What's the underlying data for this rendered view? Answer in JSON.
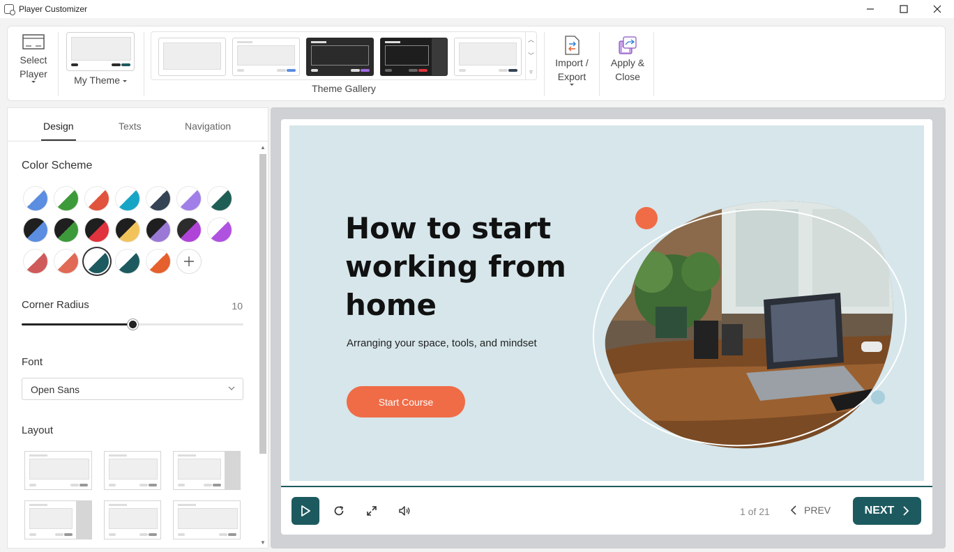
{
  "window": {
    "title": "Player Customizer"
  },
  "ribbon": {
    "select_player": "Select Player",
    "my_theme": "My Theme",
    "theme_gallery": "Theme Gallery",
    "import_export": "Import / Export",
    "apply_close": "Apply & Close"
  },
  "panel": {
    "tabs": [
      "Design",
      "Texts",
      "Navigation"
    ],
    "active_tab": "Design",
    "color_scheme_title": "Color Scheme",
    "corner_radius_title": "Corner Radius",
    "corner_radius_value": "10",
    "corner_radius_level": 0.5,
    "font_title": "Font",
    "font_value": "Open Sans",
    "layout_title": "Layout"
  },
  "colors": {
    "accent": "#1d5a5f",
    "button_orange": "#ef6c47",
    "slide_bg": "#d6e6eb"
  },
  "swatches": [
    [
      "#ffffff",
      "#5b8de0"
    ],
    [
      "#ffffff",
      "#3d9a3a"
    ],
    [
      "#ffffff",
      "#e0533d"
    ],
    [
      "#ffffff",
      "#17a5c6"
    ],
    [
      "#ffffff",
      "#354454"
    ],
    [
      "#ffffff",
      "#a07fe8"
    ],
    [
      "#ffffff",
      "#1f5e55"
    ],
    [
      "#1f1f1f",
      "#5b8de0"
    ],
    [
      "#1f1f1f",
      "#3d9a3a"
    ],
    [
      "#1f1f1f",
      "#e0333d"
    ],
    [
      "#1f1f1f",
      "#f2c35b"
    ],
    [
      "#1f1f1f",
      "#9a78d6"
    ],
    [
      "#2c2c2c",
      "#b044d8"
    ],
    [
      "#ffffff",
      "#b052e0"
    ],
    [
      "#ffffff",
      "#cf5a5a"
    ],
    [
      "#ffffff",
      "#e06a55"
    ],
    [
      "#ffffff",
      "#1d5a5f"
    ],
    [
      "#ffffff",
      "#1d5a5f"
    ],
    [
      "#ffffff",
      "#e5602d"
    ]
  ],
  "preview": {
    "title": "How to start working from home",
    "subtitle": "Arranging your space, tools, and mindset",
    "start_button": "Start Course",
    "page_count": "1 of 21",
    "prev": "PREV",
    "next": "NEXT"
  }
}
